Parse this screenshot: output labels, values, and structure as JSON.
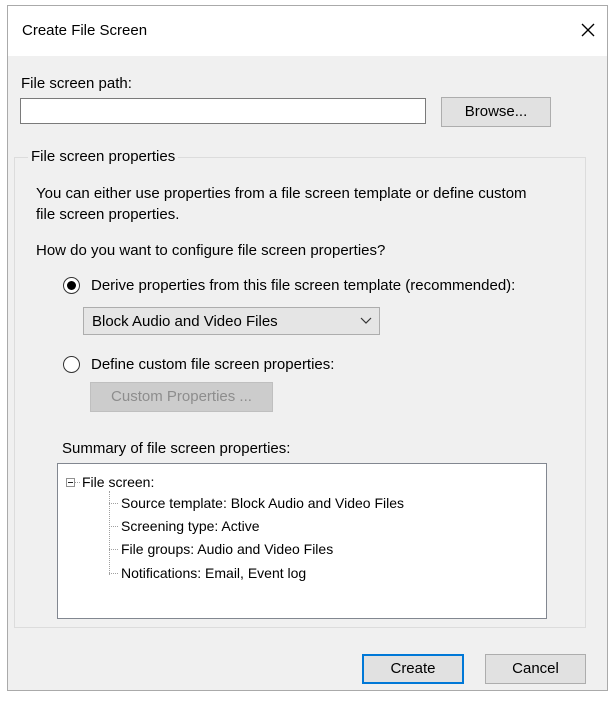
{
  "window": {
    "title": "Create File Screen",
    "close_glyph": "✕"
  },
  "path": {
    "label": "File screen path:",
    "value": "",
    "browse_label": "Browse..."
  },
  "properties": {
    "group_label": "File screen properties",
    "description_line1": "You can either use properties from a file screen template or define custom",
    "description_line2": "file screen properties.",
    "question": "How do you want to configure file screen properties?",
    "option_template_label": "Derive properties from this file screen template (recommended):",
    "option_template_selected": true,
    "template_selected_value": "Block Audio and Video Files",
    "option_custom_label": "Define custom file screen properties:",
    "option_custom_selected": false,
    "custom_button_label": "Custom Properties ...",
    "summary_label": "Summary of file screen properties:",
    "summary": {
      "root": "File screen:",
      "items": [
        "Source template: Block Audio and Video Files",
        "Screening type: Active",
        "File groups: Audio and Video Files",
        "Notifications: Email, Event log"
      ]
    }
  },
  "footer": {
    "create_label": "Create",
    "cancel_label": "Cancel"
  }
}
